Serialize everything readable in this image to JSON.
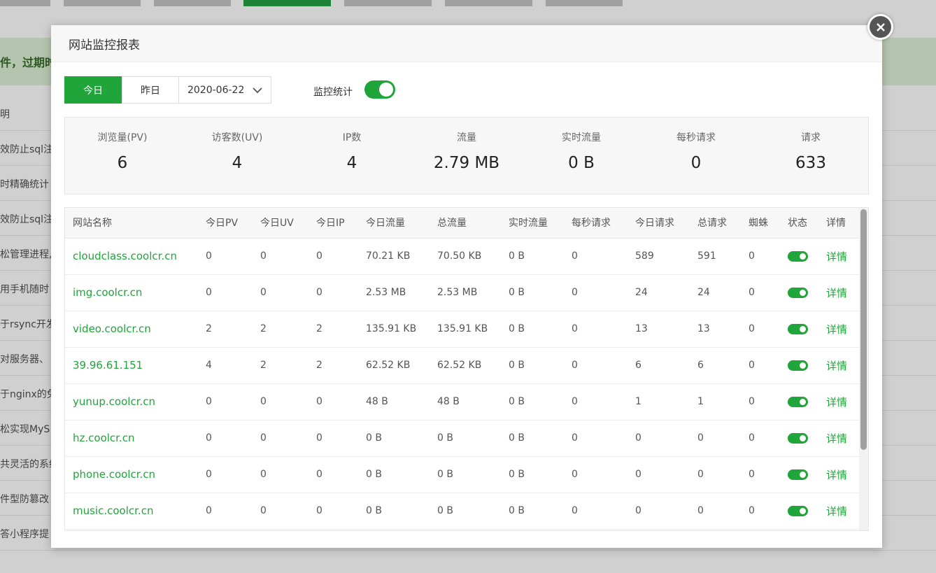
{
  "background": {
    "banner_text": "件，过期时",
    "rows": [
      "明",
      "效防止sql注",
      "时精确统计",
      "效防止sql注",
      "松管理进程,",
      "用手机随时",
      "于rsync开发",
      "对服务器、",
      "于nginx的免",
      "松实现MyS",
      "共灵活的系统",
      "件型防篡改",
      "答小程序提"
    ]
  },
  "modal": {
    "title": "网站监控报表",
    "close_icon": "close-icon",
    "toolbar": {
      "today": "今日",
      "yesterday": "昨日",
      "date": "2020-06-22",
      "monitor_label": "监控统计",
      "monitor_enabled": true
    },
    "stats": [
      {
        "label": "浏览量(PV)",
        "value": "6"
      },
      {
        "label": "访客数(UV)",
        "value": "4"
      },
      {
        "label": "IP数",
        "value": "4"
      },
      {
        "label": "流量",
        "value": "2.79 MB"
      },
      {
        "label": "实时流量",
        "value": "0 B"
      },
      {
        "label": "每秒请求",
        "value": "0"
      },
      {
        "label": "请求",
        "value": "633"
      }
    ],
    "table": {
      "headers": [
        "网站名称",
        "今日PV",
        "今日UV",
        "今日IP",
        "今日流量",
        "总流量",
        "实时流量",
        "每秒请求",
        "今日请求",
        "总请求",
        "蜘蛛",
        "状态",
        "详情"
      ],
      "rows": [
        {
          "site": "cloudclass.coolcr.cn",
          "pv": "0",
          "uv": "0",
          "ip": "0",
          "today_traffic": "70.21 KB",
          "total_traffic": "70.50 KB",
          "realtime": "0 B",
          "qps": "0",
          "today_req": "589",
          "total_req": "591",
          "spider": "0",
          "detail": "详情"
        },
        {
          "site": "img.coolcr.cn",
          "pv": "0",
          "uv": "0",
          "ip": "0",
          "today_traffic": "2.53 MB",
          "total_traffic": "2.53 MB",
          "realtime": "0 B",
          "qps": "0",
          "today_req": "24",
          "total_req": "24",
          "spider": "0",
          "detail": "详情"
        },
        {
          "site": "video.coolcr.cn",
          "pv": "2",
          "uv": "2",
          "ip": "2",
          "today_traffic": "135.91 KB",
          "total_traffic": "135.91 KB",
          "realtime": "0 B",
          "qps": "0",
          "today_req": "13",
          "total_req": "13",
          "spider": "0",
          "detail": "详情"
        },
        {
          "site": "39.96.61.151",
          "pv": "4",
          "uv": "2",
          "ip": "2",
          "today_traffic": "62.52 KB",
          "total_traffic": "62.52 KB",
          "realtime": "0 B",
          "qps": "0",
          "today_req": "6",
          "total_req": "6",
          "spider": "0",
          "detail": "详情"
        },
        {
          "site": "yunup.coolcr.cn",
          "pv": "0",
          "uv": "0",
          "ip": "0",
          "today_traffic": "48 B",
          "total_traffic": "48 B",
          "realtime": "0 B",
          "qps": "0",
          "today_req": "1",
          "total_req": "1",
          "spider": "0",
          "detail": "详情"
        },
        {
          "site": "hz.coolcr.cn",
          "pv": "0",
          "uv": "0",
          "ip": "0",
          "today_traffic": "0 B",
          "total_traffic": "0 B",
          "realtime": "0 B",
          "qps": "0",
          "today_req": "0",
          "total_req": "0",
          "spider": "0",
          "detail": "详情"
        },
        {
          "site": "phone.coolcr.cn",
          "pv": "0",
          "uv": "0",
          "ip": "0",
          "today_traffic": "0 B",
          "total_traffic": "0 B",
          "realtime": "0 B",
          "qps": "0",
          "today_req": "0",
          "total_req": "0",
          "spider": "0",
          "detail": "详情"
        },
        {
          "site": "music.coolcr.cn",
          "pv": "0",
          "uv": "0",
          "ip": "0",
          "today_traffic": "0 B",
          "total_traffic": "0 B",
          "realtime": "0 B",
          "qps": "0",
          "today_req": "0",
          "total_req": "0",
          "spider": "0",
          "detail": "详情"
        }
      ]
    }
  },
  "colors": {
    "accent": "#20a53a"
  }
}
